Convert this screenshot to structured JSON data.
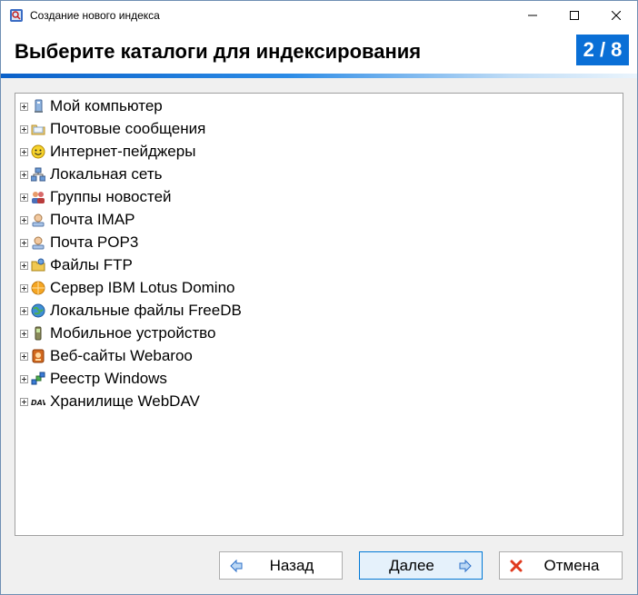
{
  "window": {
    "title": "Создание нового индекса"
  },
  "header": {
    "title": "Выберите каталоги для индексирования",
    "step": "2 / 8"
  },
  "tree": {
    "items": [
      {
        "label": "Мой компьютер",
        "icon": "computer-icon"
      },
      {
        "label": "Почтовые сообщения",
        "icon": "mail-folder-icon"
      },
      {
        "label": "Интернет-пейджеры",
        "icon": "smiley-icon"
      },
      {
        "label": "Локальная сеть",
        "icon": "network-icon"
      },
      {
        "label": "Группы новостей",
        "icon": "people-icon"
      },
      {
        "label": "Почта IMAP",
        "icon": "mail-server-icon"
      },
      {
        "label": "Почта POP3",
        "icon": "mail-server-icon"
      },
      {
        "label": "Файлы FTP",
        "icon": "ftp-folder-icon"
      },
      {
        "label": "Сервер IBM Lotus Domino",
        "icon": "domino-icon"
      },
      {
        "label": "Локальные файлы FreeDB",
        "icon": "globe-disc-icon"
      },
      {
        "label": "Мобильное устройство",
        "icon": "phone-icon"
      },
      {
        "label": "Веб-сайты Webaroo",
        "icon": "webaroo-icon"
      },
      {
        "label": "Реестр Windows",
        "icon": "registry-icon"
      },
      {
        "label": "Хранилище WebDAV",
        "icon": "webdav-icon"
      }
    ]
  },
  "buttons": {
    "back": "Назад",
    "next": "Далее",
    "cancel": "Отмена"
  }
}
